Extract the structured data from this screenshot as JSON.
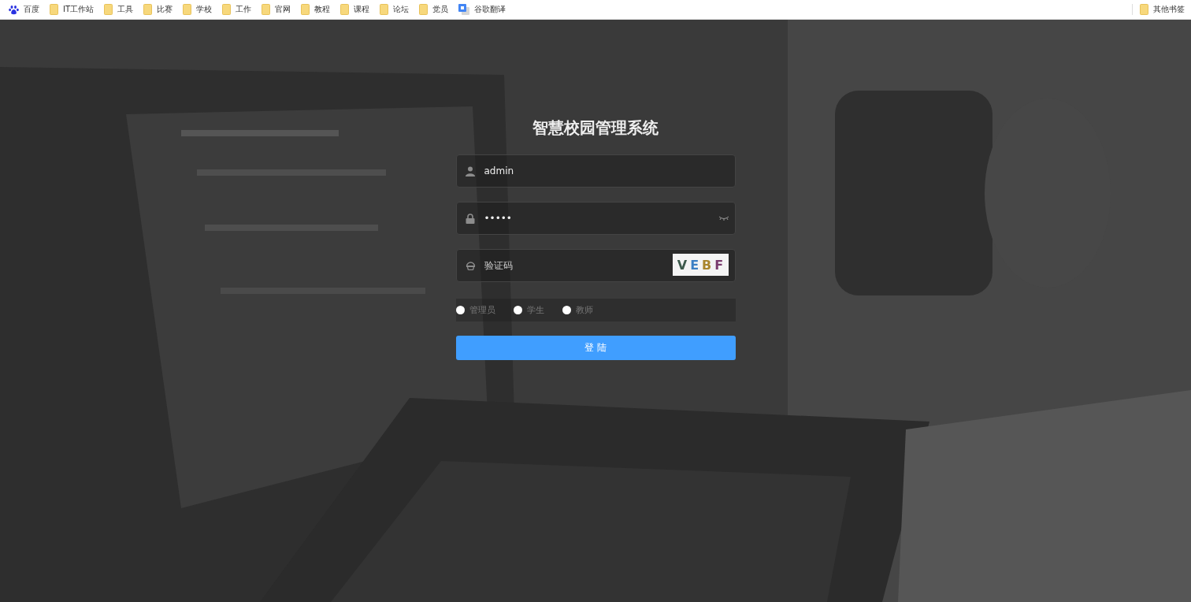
{
  "bookmarks_bar": {
    "items": [
      {
        "kind": "baidu",
        "label": "百度"
      },
      {
        "kind": "folder",
        "label": "IT工作站"
      },
      {
        "kind": "folder",
        "label": "工具"
      },
      {
        "kind": "folder",
        "label": "比赛"
      },
      {
        "kind": "folder",
        "label": "学校"
      },
      {
        "kind": "folder",
        "label": "工作"
      },
      {
        "kind": "folder",
        "label": "官网"
      },
      {
        "kind": "folder",
        "label": "教程"
      },
      {
        "kind": "folder",
        "label": "课程"
      },
      {
        "kind": "folder",
        "label": "论坛"
      },
      {
        "kind": "folder",
        "label": "党员"
      },
      {
        "kind": "translate",
        "label": "谷歌翻译"
      }
    ],
    "other": {
      "kind": "folder",
      "label": "其他书签"
    }
  },
  "login": {
    "title": "智慧校园管理系统",
    "fields": [
      {
        "kind": "user",
        "value": "admin"
      },
      {
        "kind": "password",
        "value": "•••••"
      },
      {
        "kind": "captcha",
        "placeholder": "验证码"
      }
    ],
    "captcha": [
      {
        "char": "V",
        "color": "#3d5a4c"
      },
      {
        "char": "E",
        "color": "#3b7fc4"
      },
      {
        "char": "B",
        "color": "#a9862e"
      },
      {
        "char": "F",
        "color": "#7a3b6e"
      }
    ],
    "roles": [
      {
        "label": "管理员",
        "selected": false
      },
      {
        "label": "学生",
        "selected": false
      },
      {
        "label": "教师",
        "selected": false
      }
    ],
    "submit": "登 陆"
  }
}
